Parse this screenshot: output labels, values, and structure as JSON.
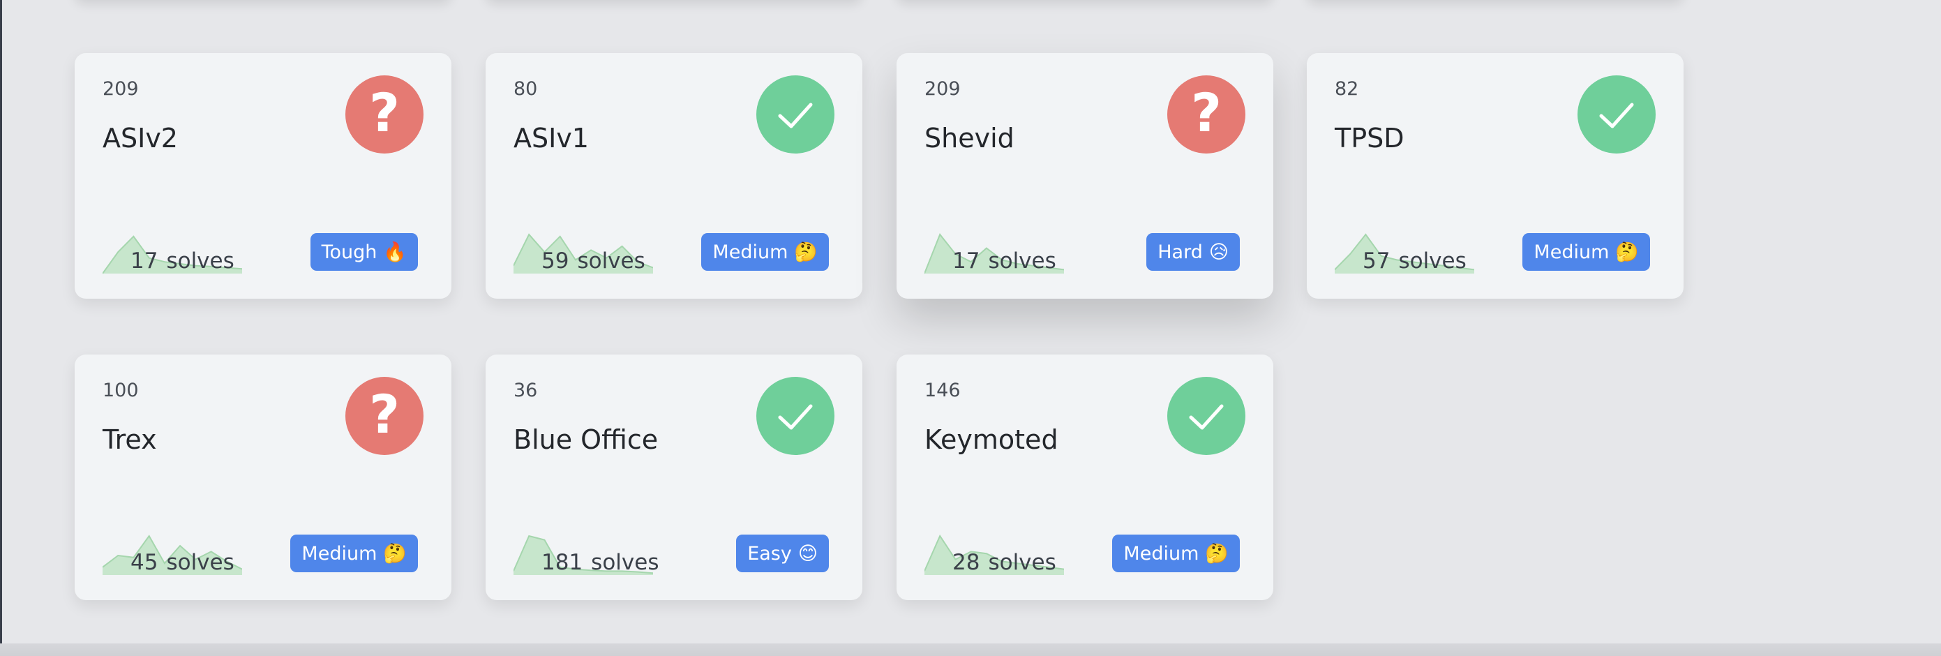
{
  "challenges": [
    {
      "points": "209",
      "name": "ASIv2",
      "solves": "17",
      "unit": "solves",
      "status": "unsolved",
      "status_icon": "question-icon",
      "difficulty": "Tough",
      "difficulty_emoji": "🔥",
      "spark_series": [
        0,
        0.55,
        0.95,
        0.4,
        0.3,
        0.25,
        0.2,
        0.18,
        0.15,
        0.12
      ]
    },
    {
      "points": "80",
      "name": "ASIv1",
      "solves": "59",
      "unit": "solves",
      "status": "solved",
      "status_icon": "check-icon",
      "difficulty": "Medium",
      "difficulty_emoji": "🤔",
      "spark_series": [
        0.2,
        1.0,
        0.55,
        0.95,
        0.35,
        0.6,
        0.4,
        0.7,
        0.3,
        0.15
      ]
    },
    {
      "points": "209",
      "name": "Shevid",
      "solves": "17",
      "unit": "solves",
      "status": "unsolved",
      "status_icon": "question-icon",
      "difficulty": "Hard",
      "difficulty_emoji": "😥",
      "spark_series": [
        0,
        1.0,
        0.5,
        0.3,
        0.65,
        0.35,
        0.25,
        0.2,
        0.15,
        0.1
      ]
    },
    {
      "points": "82",
      "name": "TPSD",
      "solves": "57",
      "unit": "solves",
      "status": "solved",
      "status_icon": "check-icon",
      "difficulty": "Medium",
      "difficulty_emoji": "🤔",
      "spark_series": [
        0.1,
        0.5,
        1.0,
        0.45,
        0.35,
        0.3,
        0.25,
        0.2,
        0.15,
        0.1
      ]
    },
    {
      "points": "100",
      "name": "Trex",
      "solves": "45",
      "unit": "solves",
      "status": "unsolved",
      "status_icon": "question-icon",
      "difficulty": "Medium",
      "difficulty_emoji": "🤔",
      "spark_series": [
        0.2,
        0.5,
        0.45,
        1.0,
        0.3,
        0.75,
        0.4,
        0.6,
        0.35,
        0.15
      ]
    },
    {
      "points": "36",
      "name": "Blue Office",
      "solves": "181",
      "unit": "solves",
      "status": "solved",
      "status_icon": "check-icon",
      "difficulty": "Easy",
      "difficulty_emoji": "😊",
      "spark_series": [
        0.1,
        1.0,
        0.9,
        0.2,
        0.15,
        0.12,
        0.1,
        0.1,
        0.08,
        0.05
      ]
    },
    {
      "points": "146",
      "name": "Keymoted",
      "solves": "28",
      "unit": "solves",
      "status": "solved",
      "status_icon": "check-icon",
      "difficulty": "Medium",
      "difficulty_emoji": "🤔",
      "spark_series": [
        0.1,
        1.0,
        0.4,
        0.6,
        0.55,
        0.35,
        0.3,
        0.25,
        0.2,
        0.15
      ]
    }
  ]
}
